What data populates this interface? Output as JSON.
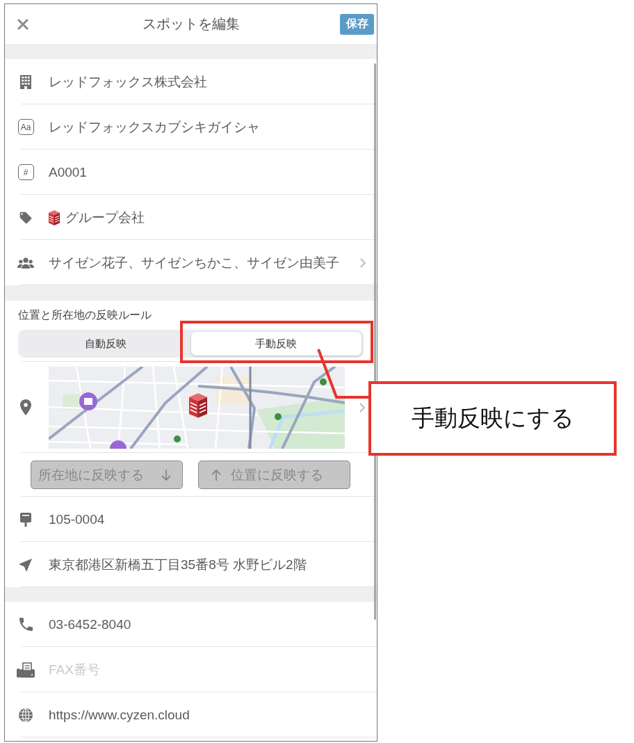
{
  "header": {
    "title": "スポットを編集",
    "save_button": "保存"
  },
  "basic_fields": [
    {
      "kind": "input",
      "value": "レッドフォックス株式会社"
    },
    {
      "kind": "input",
      "icon_glyph": "Aa",
      "value": "レッドフォックスカブシキガイシャ"
    },
    {
      "kind": "input",
      "icon_glyph": "#",
      "value": "A0001"
    },
    {
      "kind": "tag",
      "value": "グループ会社"
    },
    {
      "kind": "picker",
      "value": "サイゼン花子、サイゼンちかこ、サイゼン由美子"
    }
  ],
  "location_rule": {
    "label": "位置と所在地の反映ルール",
    "options": [
      {
        "label": "自動反映",
        "selected": false
      },
      {
        "label": "手動反映",
        "selected": true
      }
    ]
  },
  "sync_buttons": [
    {
      "kind": "down",
      "label": "所在地に反映する",
      "disabled": true
    },
    {
      "kind": "up",
      "label": "位置に反映する",
      "disabled": true
    }
  ],
  "address_fields": [
    {
      "value": "105-0004"
    },
    {
      "value": "東京都港区新橋五丁目35番8号 水野ビル2階"
    }
  ],
  "contact_fields": [
    {
      "value": "03-6452-8040"
    },
    {
      "placeholder": "FAX番号"
    },
    {
      "value": "https://www.cyzen.cloud"
    }
  ],
  "annotation": {
    "text": "手動反映にする"
  }
}
